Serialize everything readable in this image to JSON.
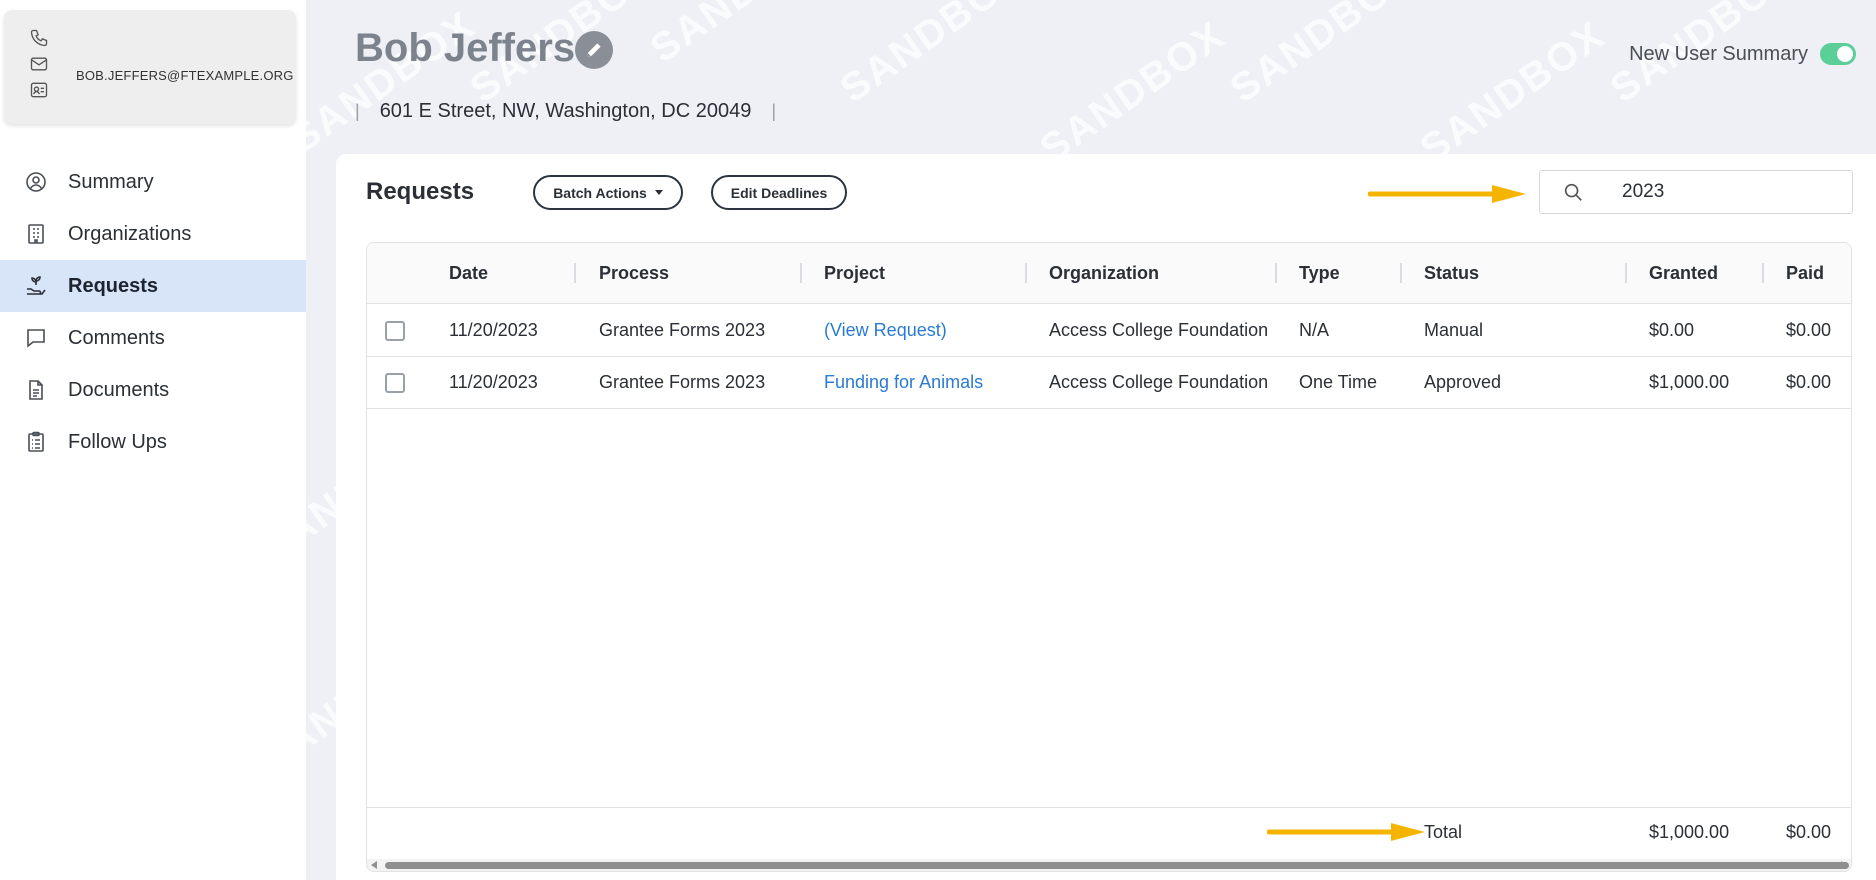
{
  "contact": {
    "email": "BOB.JEFFERS@FTEXAMPLE.ORG",
    "icons": [
      "phone-icon",
      "mail-icon",
      "contact-card-icon"
    ]
  },
  "nav": {
    "items": [
      {
        "label": "Summary",
        "icon": "user-circle-icon"
      },
      {
        "label": "Organizations",
        "icon": "building-icon"
      },
      {
        "label": "Requests",
        "icon": "hand-plant-icon",
        "active": true
      },
      {
        "label": "Comments",
        "icon": "chat-bubble-icon"
      },
      {
        "label": "Documents",
        "icon": "document-icon"
      },
      {
        "label": "Follow Ups",
        "icon": "clipboard-icon"
      }
    ]
  },
  "header": {
    "name": "Bob Jeffers",
    "address": "601 E Street, NW, Washington, DC 20049",
    "new_user_summary_label": "New User Summary",
    "new_user_summary_on": true,
    "watermark": "SANDBOX"
  },
  "requests": {
    "title": "Requests",
    "batch_actions_label": "Batch Actions",
    "edit_deadlines_label": "Edit Deadlines",
    "search_value": "2023",
    "columns": [
      "Date",
      "Process",
      "Project",
      "Organization",
      "Type",
      "Status",
      "Granted",
      "Paid"
    ],
    "rows": [
      {
        "date": "11/20/2023",
        "process": "Grantee Forms 2023",
        "project": "(View Request)",
        "organization": "Access College Foundation",
        "type": "N/A",
        "status": "Manual",
        "granted": "$0.00",
        "paid": "$0.00"
      },
      {
        "date": "11/20/2023",
        "process": "Grantee Forms 2023",
        "project": "Funding for Animals",
        "organization": "Access College Foundation",
        "type": "One Time",
        "status": "Approved",
        "granted": "$1,000.00",
        "paid": "$0.00"
      }
    ],
    "footer": {
      "label": "Total",
      "granted": "$1,000.00",
      "paid": "$0.00"
    }
  },
  "colors": {
    "accent_active_nav": "#d8e4f8",
    "link": "#2a7bd3",
    "toggle_on": "#5ccf99",
    "annotation_arrow": "#f5b400"
  }
}
